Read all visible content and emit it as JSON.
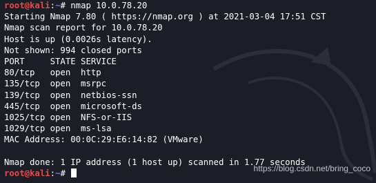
{
  "prompt": {
    "user": "root",
    "at": "@",
    "host": "kali",
    "colon": ":",
    "path": "~",
    "symbol": "#"
  },
  "command": "nmap 10.0.78.20",
  "output_lines": [
    "Starting Nmap 7.80 ( https://nmap.org ) at 2021-03-04 17:51 CST",
    "Nmap scan report for 10.0.78.20",
    "Host is up (0.0026s latency).",
    "Not shown: 994 closed ports",
    "PORT     STATE SERVICE",
    "80/tcp   open  http",
    "135/tcp  open  msrpc",
    "139/tcp  open  netbios-ssn",
    "445/tcp  open  microsoft-ds",
    "1025/tcp open  NFS-or-IIS",
    "1029/tcp open  ms-lsa",
    "MAC Address: 00:0C:29:E6:14:82 (VMware)",
    "",
    "Nmap done: 1 IP address (1 host up) scanned in 1.77 seconds"
  ],
  "watermark_url": "https://blog.csdn.net/bring_coco",
  "colors": {
    "background": "#1b1e26",
    "prompt_user_host": "#e74b4b",
    "prompt_path": "#5c7cfa",
    "text": "#ffffff"
  },
  "icons": {
    "background_logo": "kali-dragon-icon",
    "cursor": "block-cursor"
  }
}
